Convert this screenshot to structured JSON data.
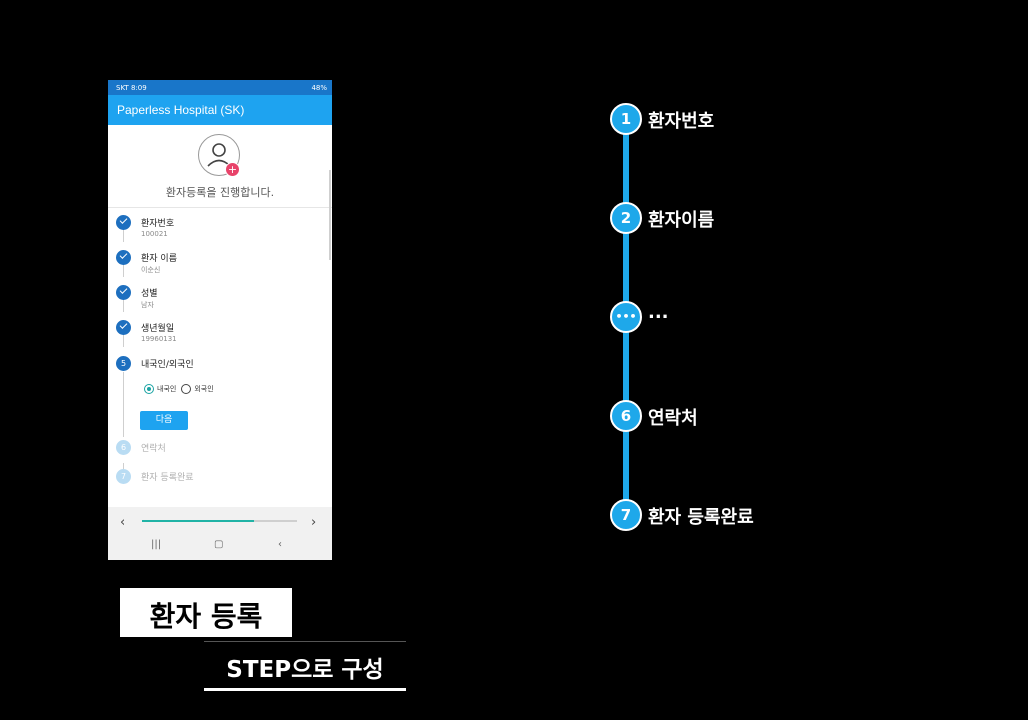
{
  "phone": {
    "status": {
      "left": "SKT 8:09",
      "right": "48%"
    },
    "app_title": "Paperless Hospital (SK)",
    "intro": "환자등록을 진행합니다.",
    "steps": [
      {
        "num": "",
        "title": "환자번호",
        "value": "100021",
        "state": "done"
      },
      {
        "num": "",
        "title": "환자 이름",
        "value": "이순신",
        "state": "done"
      },
      {
        "num": "",
        "title": "성별",
        "value": "남자",
        "state": "done"
      },
      {
        "num": "",
        "title": "생년월일",
        "value": "19960131",
        "state": "done"
      },
      {
        "num": "5",
        "title": "내국인/외국인",
        "value": "",
        "state": "active"
      },
      {
        "num": "6",
        "title": "연락처",
        "value": "",
        "state": "pending"
      },
      {
        "num": "7",
        "title": "환자 등록완료",
        "value": "",
        "state": "pending"
      }
    ],
    "radio_options": [
      {
        "label": "내국인",
        "selected": true
      },
      {
        "label": "외국인",
        "selected": false
      }
    ],
    "next_label": "다음",
    "progress": 0.72,
    "nav": {
      "prev": "‹",
      "next": "›",
      "recents": "|||",
      "home": "▢",
      "back": "‹"
    }
  },
  "timeline": [
    {
      "badge": "1",
      "label": "환자번호"
    },
    {
      "badge": "2",
      "label": "환자이름"
    },
    {
      "badge": "•••",
      "label": "..."
    },
    {
      "badge": "6",
      "label": "연락처"
    },
    {
      "badge": "7",
      "label": "환자 등록완료"
    }
  ],
  "captions": {
    "main": "환자 등록",
    "sub": "STEP으로 구성"
  },
  "colors": {
    "accent": "#1ea3f0",
    "step_done": "#1d6fbf",
    "timeline": "#1ea8ea",
    "plus": "#e8436a"
  }
}
